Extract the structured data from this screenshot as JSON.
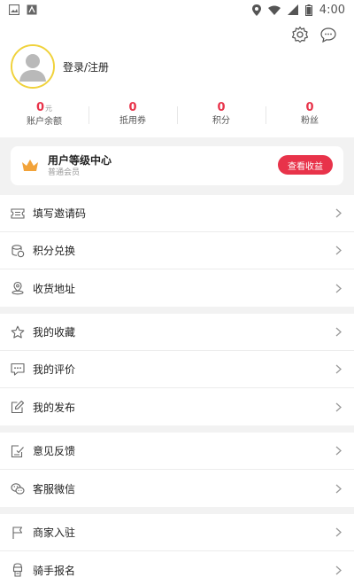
{
  "status_bar": {
    "time": "4:00"
  },
  "profile": {
    "login_label": "登录/注册"
  },
  "stats": [
    {
      "value": "0",
      "unit": "元",
      "label": "账户余额"
    },
    {
      "value": "0",
      "unit": "",
      "label": "抵用券"
    },
    {
      "value": "0",
      "unit": "",
      "label": "积分"
    },
    {
      "value": "0",
      "unit": "",
      "label": "粉丝"
    }
  ],
  "vip": {
    "title": "用户等级中心",
    "subtitle": "普通会员",
    "button": "查看收益"
  },
  "menu_groups": [
    [
      {
        "label": "填写邀请码",
        "icon": "ticket-icon"
      },
      {
        "label": "积分兑换",
        "icon": "coins-icon"
      },
      {
        "label": "收货地址",
        "icon": "location-icon"
      }
    ],
    [
      {
        "label": "我的收藏",
        "icon": "star-icon"
      },
      {
        "label": "我的评价",
        "icon": "comment-icon"
      },
      {
        "label": "我的发布",
        "icon": "edit-icon"
      }
    ],
    [
      {
        "label": "意见反馈",
        "icon": "feedback-icon"
      },
      {
        "label": "客服微信",
        "icon": "wechat-icon"
      }
    ],
    [
      {
        "label": "商家入驻",
        "icon": "flag-icon"
      },
      {
        "label": "骑手报名",
        "icon": "rider-icon"
      }
    ]
  ],
  "colors": {
    "accent": "#e8334a",
    "avatar_ring": "#f0d23c",
    "crown": "#f2a33a"
  }
}
